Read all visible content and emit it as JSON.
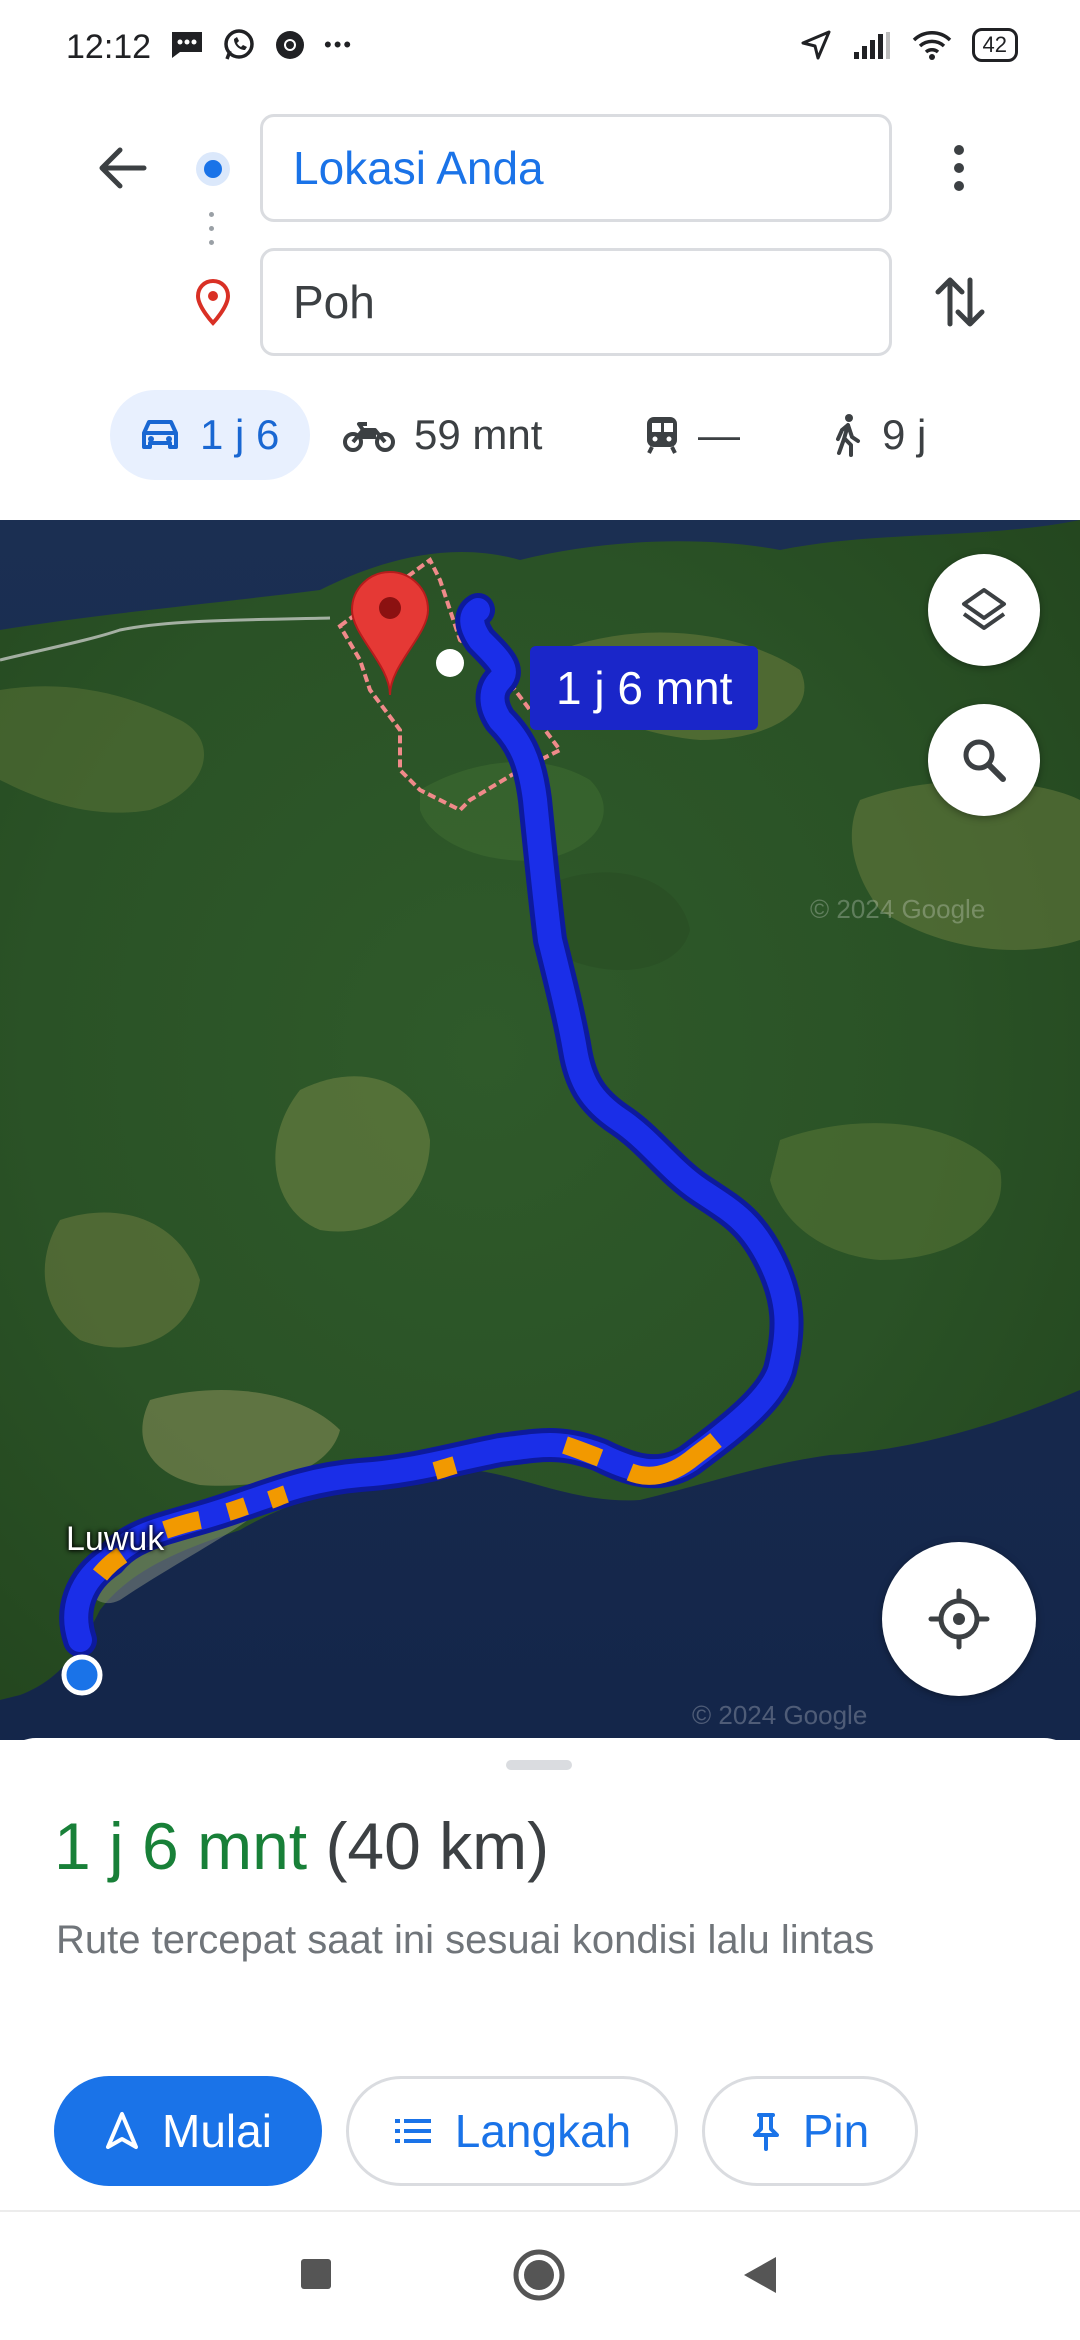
{
  "status_bar": {
    "time": "12:12",
    "battery": "42",
    "left_icons": [
      "message-icon",
      "whatsapp-icon",
      "chrome-icon",
      "more-dots-icon"
    ],
    "right_icons": [
      "location-arrow-icon",
      "signal-icon",
      "wifi-icon",
      "battery-icon"
    ],
    "more_dots": "•••"
  },
  "search": {
    "origin": "Lokasi Anda",
    "destination": "Poh"
  },
  "modes": [
    {
      "icon": "car-icon",
      "label": "1 j 6",
      "selected": true
    },
    {
      "icon": "motorcycle-icon",
      "label": "59 mnt"
    },
    {
      "icon": "transit-icon",
      "label": "—"
    },
    {
      "icon": "walk-icon",
      "label": "9 j"
    }
  ],
  "map": {
    "route_label": "1 j 6 mnt",
    "place_label": "Luwuk",
    "watermark": "© 2024 Google",
    "route_color": "#1a2ee8",
    "traffic_color": "#f29900"
  },
  "summary": {
    "duration": "1 j 6 mnt",
    "distance": "(40 km)",
    "description": "Rute tercepat saat ini sesuai kondisi lalu lintas"
  },
  "actions": {
    "start": "Mulai",
    "steps": "Langkah",
    "pin": "Pin"
  },
  "colors": {
    "accent": "#1a73e8",
    "duration_green": "#188038"
  }
}
